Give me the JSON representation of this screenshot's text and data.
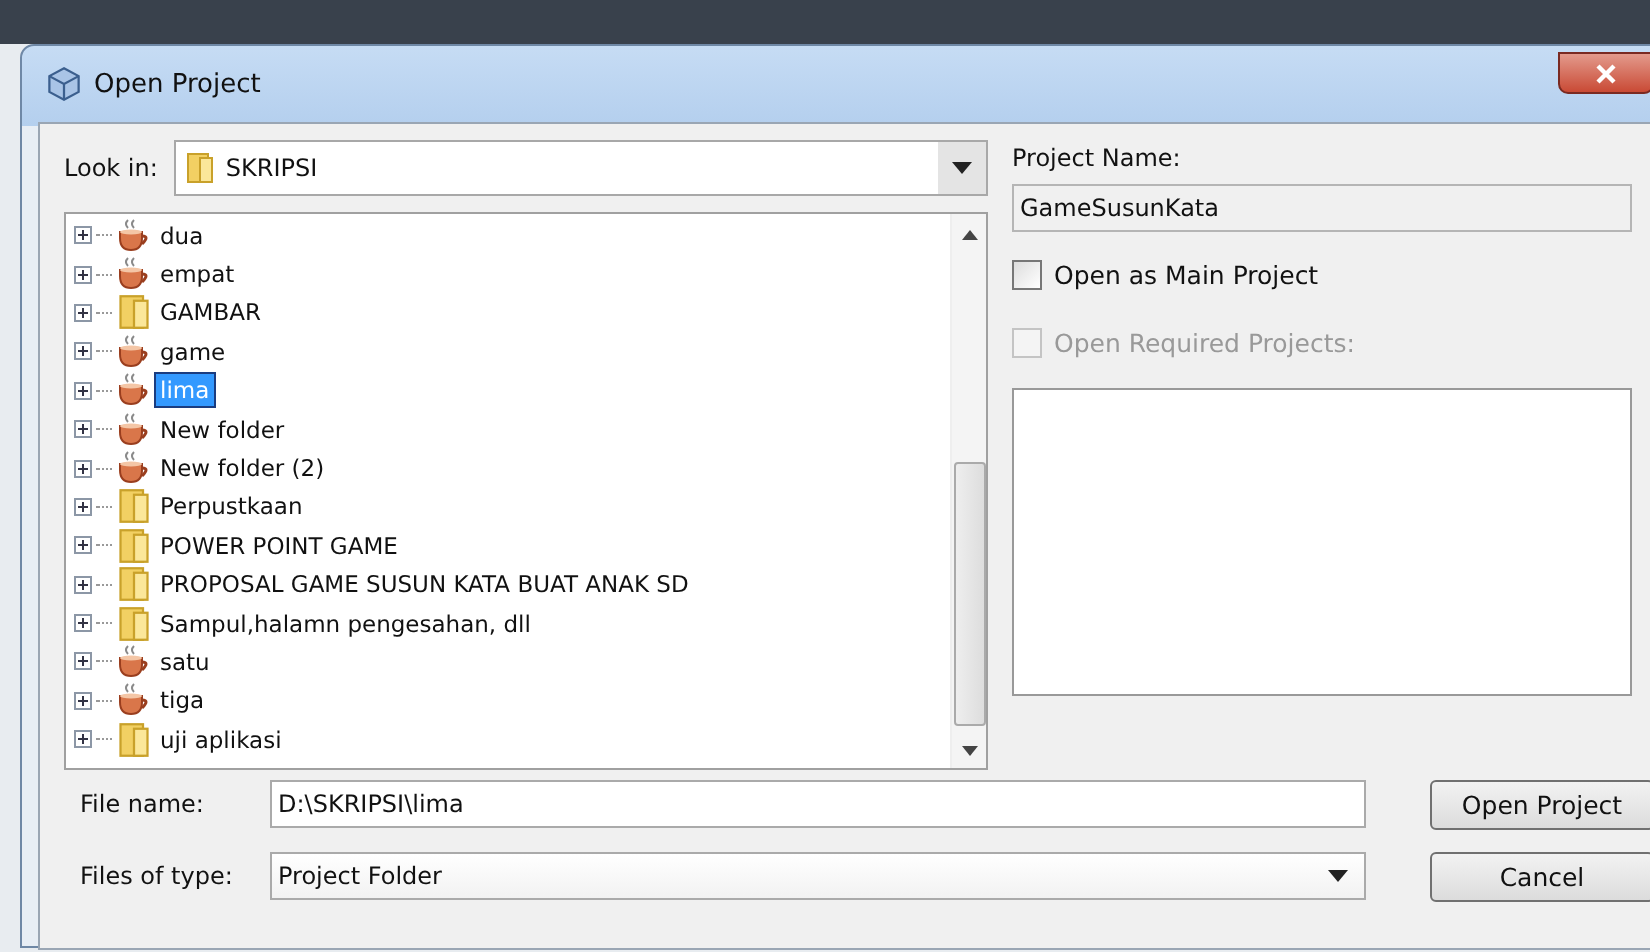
{
  "window": {
    "title": "Open Project"
  },
  "look_in": {
    "label": "Look in:",
    "value": "SKRIPSI"
  },
  "tree": {
    "items": [
      {
        "label": "dua",
        "kind": "project",
        "selected": false
      },
      {
        "label": "empat",
        "kind": "project",
        "selected": false
      },
      {
        "label": "GAMBAR",
        "kind": "folder",
        "selected": false
      },
      {
        "label": "game",
        "kind": "project",
        "selected": false
      },
      {
        "label": "lima",
        "kind": "project",
        "selected": true
      },
      {
        "label": "New folder",
        "kind": "project",
        "selected": false
      },
      {
        "label": "New folder (2)",
        "kind": "project",
        "selected": false
      },
      {
        "label": "Perpustkaan",
        "kind": "folder",
        "selected": false
      },
      {
        "label": "POWER POINT GAME",
        "kind": "folder",
        "selected": false
      },
      {
        "label": "PROPOSAL GAME SUSUN KATA BUAT ANAK SD",
        "kind": "folder",
        "selected": false
      },
      {
        "label": "Sampul,halamn pengesahan, dll",
        "kind": "folder",
        "selected": false
      },
      {
        "label": "satu",
        "kind": "project",
        "selected": false
      },
      {
        "label": "tiga",
        "kind": "project",
        "selected": false
      },
      {
        "label": "uji aplikasi",
        "kind": "folder",
        "selected": false
      }
    ]
  },
  "project_name": {
    "label": "Project Name:",
    "value": "GameSusunKata"
  },
  "options": [
    {
      "label": "Open as Main Project",
      "checked": false,
      "disabled": false
    },
    {
      "label": "Open Required Projects:",
      "checked": false,
      "disabled": true
    }
  ],
  "file_name": {
    "label": "File name:",
    "value": "D:\\SKRIPSI\\lima"
  },
  "files_of_type": {
    "label": "Files of type:",
    "value": "Project Folder"
  },
  "buttons": [
    "Open Project",
    "Cancel"
  ]
}
